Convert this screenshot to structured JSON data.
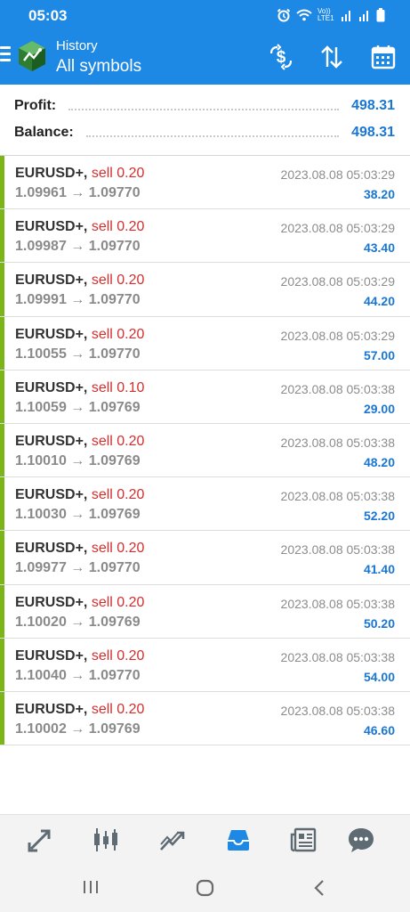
{
  "status_bar": {
    "time": "05:03",
    "network": "Vo)) LTE1"
  },
  "app_bar": {
    "subtitle": "History",
    "title": "All symbols",
    "actions": [
      "currency-filter-icon",
      "sort-icon",
      "calendar-icon"
    ]
  },
  "summary": {
    "profit_label": "Profit:",
    "profit_value": "498.31",
    "balance_label": "Balance:",
    "balance_value": "498.31"
  },
  "deals": [
    {
      "symbol": "EURUSD+,",
      "type": "sell 0.20",
      "open": "1.09961",
      "close": "1.09770",
      "arrow": "→",
      "time": "2023.08.08 05:03:29",
      "profit": "38.20"
    },
    {
      "symbol": "EURUSD+,",
      "type": "sell 0.20",
      "open": "1.09987",
      "close": "1.09770",
      "arrow": "→",
      "time": "2023.08.08 05:03:29",
      "profit": "43.40"
    },
    {
      "symbol": "EURUSD+,",
      "type": "sell 0.20",
      "open": "1.09991",
      "close": "1.09770",
      "arrow": "→",
      "time": "2023.08.08 05:03:29",
      "profit": "44.20"
    },
    {
      "symbol": "EURUSD+,",
      "type": "sell 0.20",
      "open": "1.10055",
      "close": "1.09770",
      "arrow": "→",
      "time": "2023.08.08 05:03:29",
      "profit": "57.00"
    },
    {
      "symbol": "EURUSD+,",
      "type": "sell 0.10",
      "open": "1.10059",
      "close": "1.09769",
      "arrow": "→",
      "time": "2023.08.08 05:03:38",
      "profit": "29.00"
    },
    {
      "symbol": "EURUSD+,",
      "type": "sell 0.20",
      "open": "1.10010",
      "close": "1.09769",
      "arrow": "→",
      "time": "2023.08.08 05:03:38",
      "profit": "48.20"
    },
    {
      "symbol": "EURUSD+,",
      "type": "sell 0.20",
      "open": "1.10030",
      "close": "1.09769",
      "arrow": "→",
      "time": "2023.08.08 05:03:38",
      "profit": "52.20"
    },
    {
      "symbol": "EURUSD+,",
      "type": "sell 0.20",
      "open": "1.09977",
      "close": "1.09770",
      "arrow": "→",
      "time": "2023.08.08 05:03:38",
      "profit": "41.40"
    },
    {
      "symbol": "EURUSD+,",
      "type": "sell 0.20",
      "open": "1.10020",
      "close": "1.09769",
      "arrow": "→",
      "time": "2023.08.08 05:03:38",
      "profit": "50.20"
    },
    {
      "symbol": "EURUSD+,",
      "type": "sell 0.20",
      "open": "1.10040",
      "close": "1.09770",
      "arrow": "→",
      "time": "2023.08.08 05:03:38",
      "profit": "54.00"
    },
    {
      "symbol": "EURUSD+,",
      "type": "sell 0.20",
      "open": "1.10002",
      "close": "1.09769",
      "arrow": "→",
      "time": "2023.08.08 05:03:38",
      "profit": "46.60"
    }
  ],
  "bottom_nav": {
    "items": [
      "quotes-icon",
      "chart-icon",
      "trade-icon",
      "history-icon",
      "news-icon",
      "chat-icon"
    ],
    "active": "history-icon",
    "active_color": "#1e88e5",
    "inactive_color": "#5f6b73"
  },
  "system_nav": [
    "recents-icon",
    "home-icon",
    "back-icon"
  ],
  "colors": {
    "brand": "#1e88e5",
    "sell": "#d32f2f",
    "profit": "#1976d2",
    "deal_marker": "#7cb518"
  }
}
